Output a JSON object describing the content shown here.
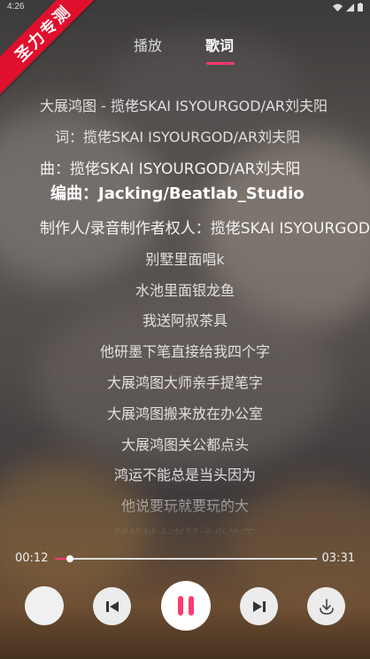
{
  "status_bar": {
    "time": "4:26"
  },
  "watermark": {
    "text": "圣力专测"
  },
  "tabs": [
    {
      "label": "播放"
    },
    {
      "label": "歌词"
    }
  ],
  "lyrics": [
    "大展鸿图 - 揽佬SKAI ISYOURGOD/AR刘夫阳",
    "词：揽佬SKAI ISYOURGOD/AR刘夫阳",
    "曲：揽佬SKAI ISYOURGOD/AR刘夫阳",
    "编曲：Jacking/Beatlab_Studio",
    "制作人/录音制作者权人：揽佬SKAI ISYOURGOD",
    "别墅里面唱k",
    "水池里面银龙鱼",
    "我送阿叔茶具",
    "他研墨下笔直接给我四个字",
    "大展鸿图大师亲手提笔字",
    "大展鸿图搬来放在办公室",
    "大展鸿图关公都点头",
    "鸿运不能总是当头因为",
    "他说要玩就要玩的大",
    "贼船越大老鼠才坐的下"
  ],
  "player": {
    "current_time": "00:12",
    "total_time": "03:31",
    "progress": 0.057
  },
  "icons": {
    "prev": "skip-previous-icon",
    "pause": "pause-icon",
    "next": "skip-next-icon",
    "download": "download-icon"
  },
  "colors": {
    "accent": "#ff3a6e",
    "ribbon": "#e0102d"
  }
}
